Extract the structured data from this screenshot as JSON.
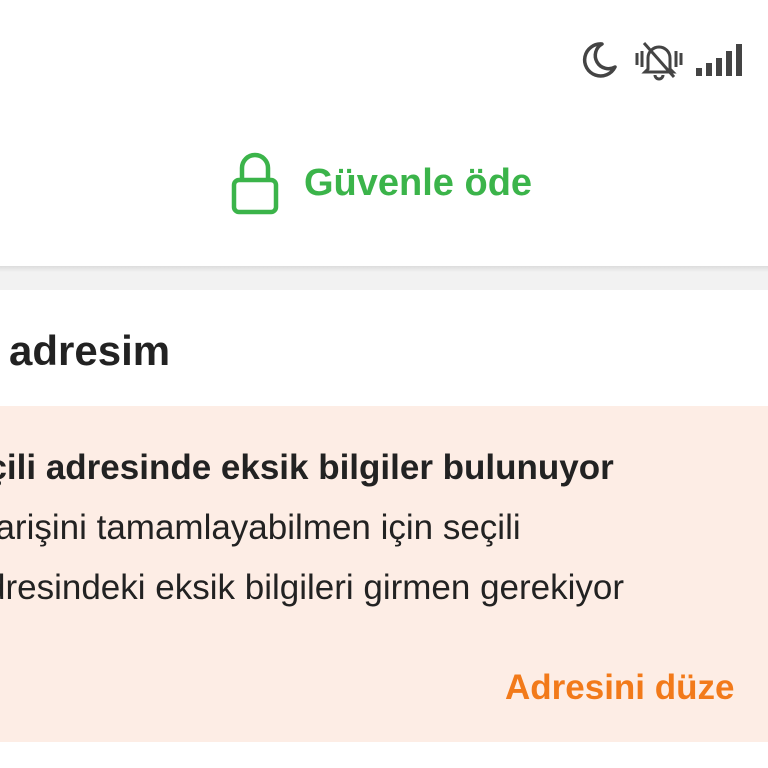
{
  "status_bar": {
    "icons": [
      "moon-icon",
      "bell-muted-icon",
      "signal-icon"
    ]
  },
  "header": {
    "icon": "lock-icon",
    "title": "Güvenle öde"
  },
  "address_section": {
    "title": "at adresim",
    "warning": {
      "title": "eçili adresinde eksik bilgiler bulunuyor",
      "line_1": "parişini tamamlayabilmen için seçili",
      "line_2": "dresindeki eksik bilgileri girmen gerekiyor",
      "link_label": "Adresini düze"
    }
  },
  "colors": {
    "accent_green": "#3bb44a",
    "accent_orange": "#f27a1a",
    "warning_background": "#fdede5",
    "text": "#222222"
  }
}
